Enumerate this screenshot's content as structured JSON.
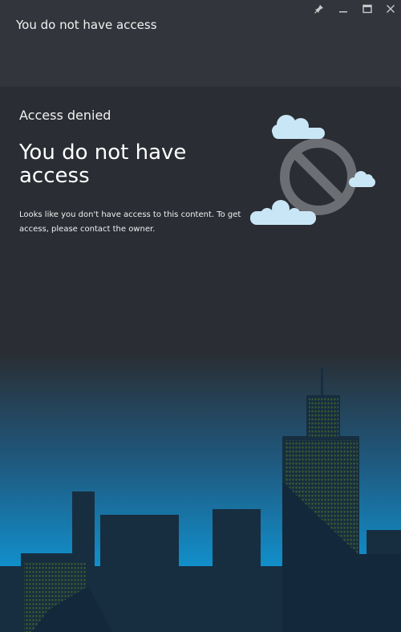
{
  "window": {
    "title": "You do not have access",
    "controls": {
      "pin": "pin-icon",
      "minimize": "minimize-icon",
      "maximize": "maximize-icon",
      "close": "close-icon"
    }
  },
  "main": {
    "label": "Access denied",
    "heading": "You do not have access",
    "message": "Looks like you don't have access to this content. To get access, please contact the owner."
  },
  "illustration": {
    "icon": "no-access-icon",
    "clouds": [
      "cloud-icon",
      "cloud-icon",
      "cloud-icon"
    ]
  },
  "colors": {
    "titlebar": "#32353b",
    "background": "#2a2d33",
    "sky_bottom": "#0b9ae0",
    "building": "#172e40",
    "window_lights": "#3b5e2e",
    "cloud": "#c9e6f6",
    "no_sign": "#6b6e73"
  }
}
